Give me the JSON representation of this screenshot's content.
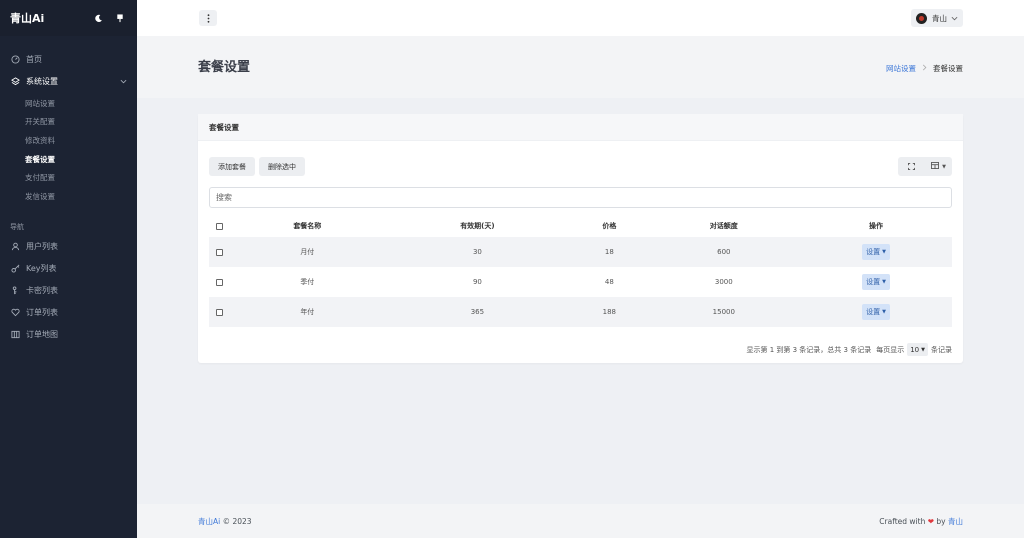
{
  "brand": {
    "name": "青山Ai"
  },
  "sidebar": {
    "items": [
      {
        "label": "首页"
      },
      {
        "label": "系统设置"
      }
    ],
    "submenu": [
      {
        "label": "网站设置"
      },
      {
        "label": "开关配置"
      },
      {
        "label": "修改资料"
      },
      {
        "label": "套餐设置"
      },
      {
        "label": "支付配置"
      },
      {
        "label": "发信设置"
      }
    ],
    "section": "导航",
    "nav": [
      {
        "label": "用户列表"
      },
      {
        "label": "Key列表"
      },
      {
        "label": "卡密列表"
      },
      {
        "label": "订单列表"
      },
      {
        "label": "订单地图"
      }
    ]
  },
  "topbar": {
    "user_name": "青山"
  },
  "page": {
    "title": "套餐设置"
  },
  "breadcrumb": {
    "parent": "网站设置",
    "current": "套餐设置"
  },
  "card": {
    "title": "套餐设置",
    "add_button": "添加套餐",
    "delete_button": "删除选中",
    "search_placeholder": "搜索"
  },
  "table": {
    "headers": [
      "套餐名称",
      "有效期(天)",
      "价格",
      "对话额度",
      "操作"
    ],
    "action_label": "设置",
    "rows": [
      {
        "name": "月付",
        "days": "30",
        "price": "18",
        "quota": "600"
      },
      {
        "name": "季付",
        "days": "90",
        "price": "48",
        "quota": "3000"
      },
      {
        "name": "年付",
        "days": "365",
        "price": "188",
        "quota": "15000"
      }
    ]
  },
  "pager": {
    "summary": "显示第 1 到第 3 条记录，总共 3 条记录",
    "per_page_prefix": "每页显示",
    "per_page_value": "10",
    "per_page_suffix": "条记录"
  },
  "footer": {
    "brand": "青山Ai",
    "copyright": "© 2023",
    "crafted_prefix": "Crafted with",
    "by": "by",
    "author": "青山"
  },
  "colors": {
    "accent": "#3e78d8",
    "sidebar_bg": "#1c2333",
    "heart": "#e0393e"
  }
}
